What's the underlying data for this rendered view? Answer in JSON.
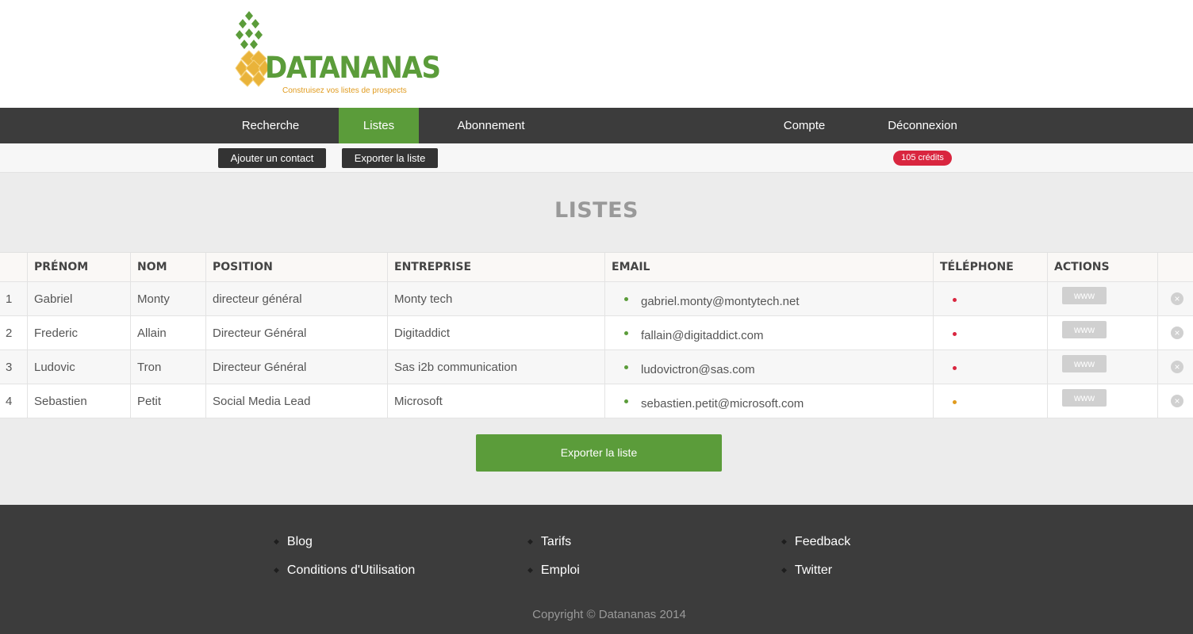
{
  "brand": {
    "name": "DATANANAS",
    "tagline": "Construisez vos listes de prospects",
    "colors": {
      "green": "#5b9c3a",
      "orange": "#e09b1e"
    }
  },
  "nav": {
    "items": [
      {
        "label": "Recherche"
      },
      {
        "label": "Listes",
        "active": true
      },
      {
        "label": "Abonnement"
      },
      {
        "label": "Compte"
      },
      {
        "label": "Déconnexion"
      }
    ]
  },
  "toolbar": {
    "add_contact": "Ajouter un contact",
    "export_list": "Exporter la liste",
    "credits": "105 crédits"
  },
  "page_title": "LISTES",
  "table": {
    "headers": [
      "",
      "PRÉNOM",
      "NOM",
      "POSITION",
      "ENTREPRISE",
      "EMAIL",
      "TÉLÉPHONE",
      "ACTIONS"
    ],
    "rows": [
      {
        "index": "1",
        "prenom": "Gabriel",
        "nom": "Monty",
        "position": "directeur général",
        "entreprise": "Monty tech",
        "email": "gabriel.monty@montytech.net",
        "email_status_color": "#5b9c3a",
        "phone_status_color": "#d9263f",
        "action_label": "www"
      },
      {
        "index": "2",
        "prenom": "Frederic",
        "nom": "Allain",
        "position": "Directeur Général",
        "entreprise": "Digitaddict",
        "email": "fallain@digitaddict.com",
        "email_status_color": "#5b9c3a",
        "phone_status_color": "#d9263f",
        "action_label": "www"
      },
      {
        "index": "3",
        "prenom": "Ludovic",
        "nom": "Tron",
        "position": "Directeur Général",
        "entreprise": "Sas i2b communication",
        "email": "ludovictron@sas.com",
        "email_status_color": "#5b9c3a",
        "phone_status_color": "#d9263f",
        "action_label": "www"
      },
      {
        "index": "4",
        "prenom": "Sebastien",
        "nom": "Petit",
        "position": "Social Media Lead",
        "entreprise": "Microsoft",
        "email": "sebastien.petit@microsoft.com",
        "email_status_color": "#5b9c3a",
        "phone_status_color": "#e09b1e",
        "action_label": "www"
      }
    ],
    "delete_icon": "close-circle-icon"
  },
  "export_button": "Exporter la liste",
  "footer": {
    "links": [
      "Blog",
      "Tarifs",
      "Feedback",
      "Conditions d'Utilisation",
      "Emploi",
      "Twitter"
    ],
    "copyright": "Copyright © Datananas 2014"
  }
}
